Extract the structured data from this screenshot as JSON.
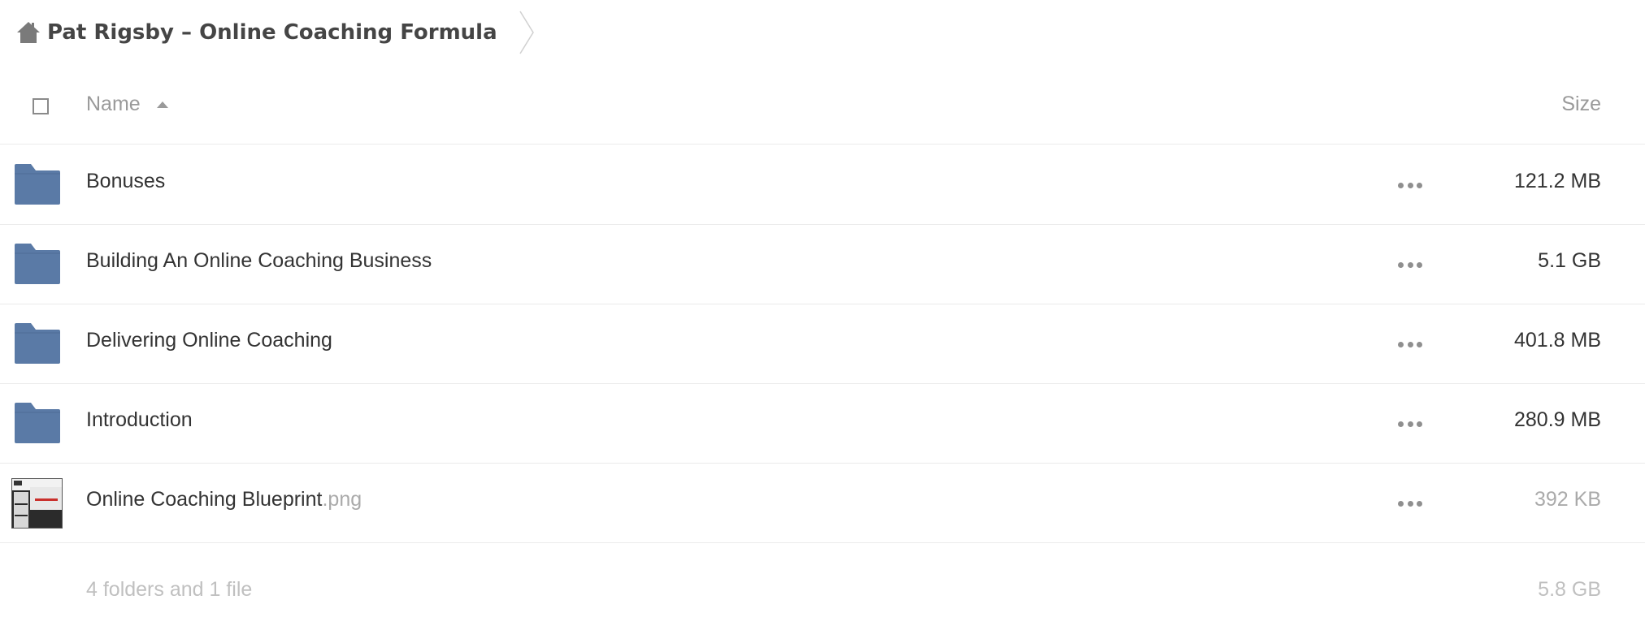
{
  "breadcrumb": {
    "home_icon": "home-icon",
    "title": "Pat Rigsby – Online Coaching Formula"
  },
  "table": {
    "columns": {
      "name": "Name",
      "size": "Size"
    },
    "sort": "name-ascending",
    "rows": [
      {
        "type": "folder",
        "name": "Bonuses",
        "ext": "",
        "size": "121.2 MB"
      },
      {
        "type": "folder",
        "name": "Building An Online Coaching Business",
        "ext": "",
        "size": "5.1 GB"
      },
      {
        "type": "folder",
        "name": "Delivering Online Coaching",
        "ext": "",
        "size": "401.8 MB"
      },
      {
        "type": "folder",
        "name": "Introduction",
        "ext": "",
        "size": "280.9 MB"
      },
      {
        "type": "file",
        "name": "Online Coaching Blueprint",
        "ext": ".png",
        "size": "392 KB"
      }
    ],
    "summary": {
      "count": "4 folders and 1 file",
      "total": "5.8 GB"
    }
  },
  "colors": {
    "folder": "#5a7aa6",
    "text": "#333333",
    "muted": "#9a9a9a"
  }
}
